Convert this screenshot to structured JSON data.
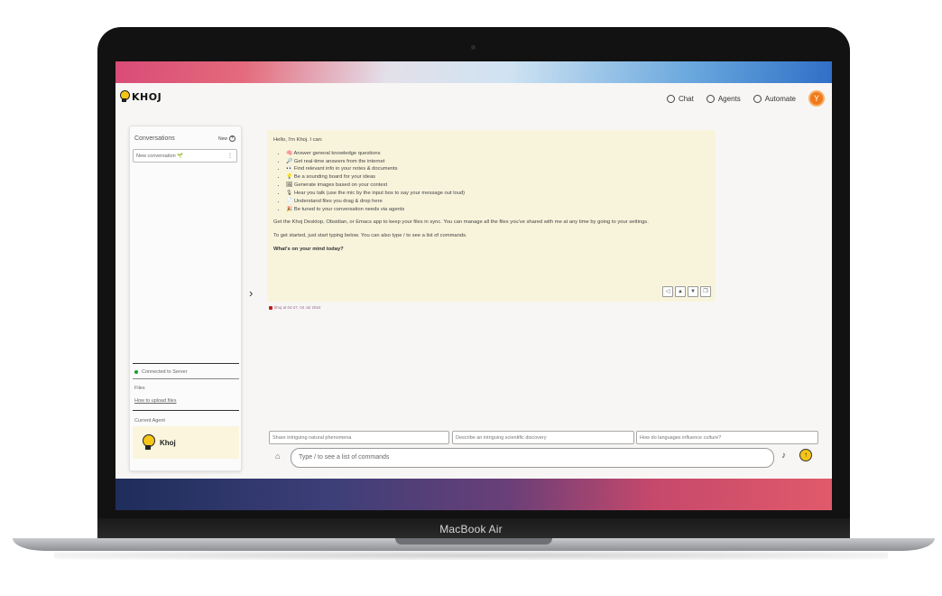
{
  "device": {
    "brand": "MacBook Air"
  },
  "header": {
    "logo": "KHOJ",
    "nav": [
      {
        "label": "Chat",
        "icon": "chat-icon"
      },
      {
        "label": "Agents",
        "icon": "agents-icon"
      },
      {
        "label": "Automate",
        "icon": "automate-icon"
      }
    ],
    "avatar_initial": "Y"
  },
  "sidebar": {
    "title": "Conversations",
    "new_label": "New",
    "new_conversation": "New conversation 🌱",
    "status": "Connected to Server",
    "files_label": "Files",
    "upload_link": "How to upload files",
    "current_agent_label": "Current Agent",
    "agent_name": "Khoj"
  },
  "message": {
    "greeting": "Hello, I'm Khoj. I can:",
    "capabilities": [
      "🧠 Answer general knowledge questions",
      "🔎 Get real-time answers from the internet",
      "👀 Find relevant info in your notes & documents",
      "💡 Be a sounding board for your ideas",
      "🖼 Generate images based on your context",
      "🎙 Hear you talk (use the mic by the input box to say your message out loud)",
      "📄 Understand files you drag & drop here",
      "🎉 Be tuned to your conversation needs via agents"
    ],
    "sync_text": "Get the Khoj Desktop, Obsidian, or Emacs app to keep your files in sync. You can manage all the files you've shared with me at any time by going to your settings.",
    "start_text": "To get started, just start typing below. You can also type / to see a list of commands.",
    "question": "What's on your mind today?",
    "meta": "khoj at 04:47, 04 Jul 2024"
  },
  "suggestions": [
    "Share intriguing natural phenomena",
    "Describe an intriguing scientific discovery",
    "How do languages influence culture?"
  ],
  "input": {
    "placeholder": "Type / to see a list of commands"
  }
}
